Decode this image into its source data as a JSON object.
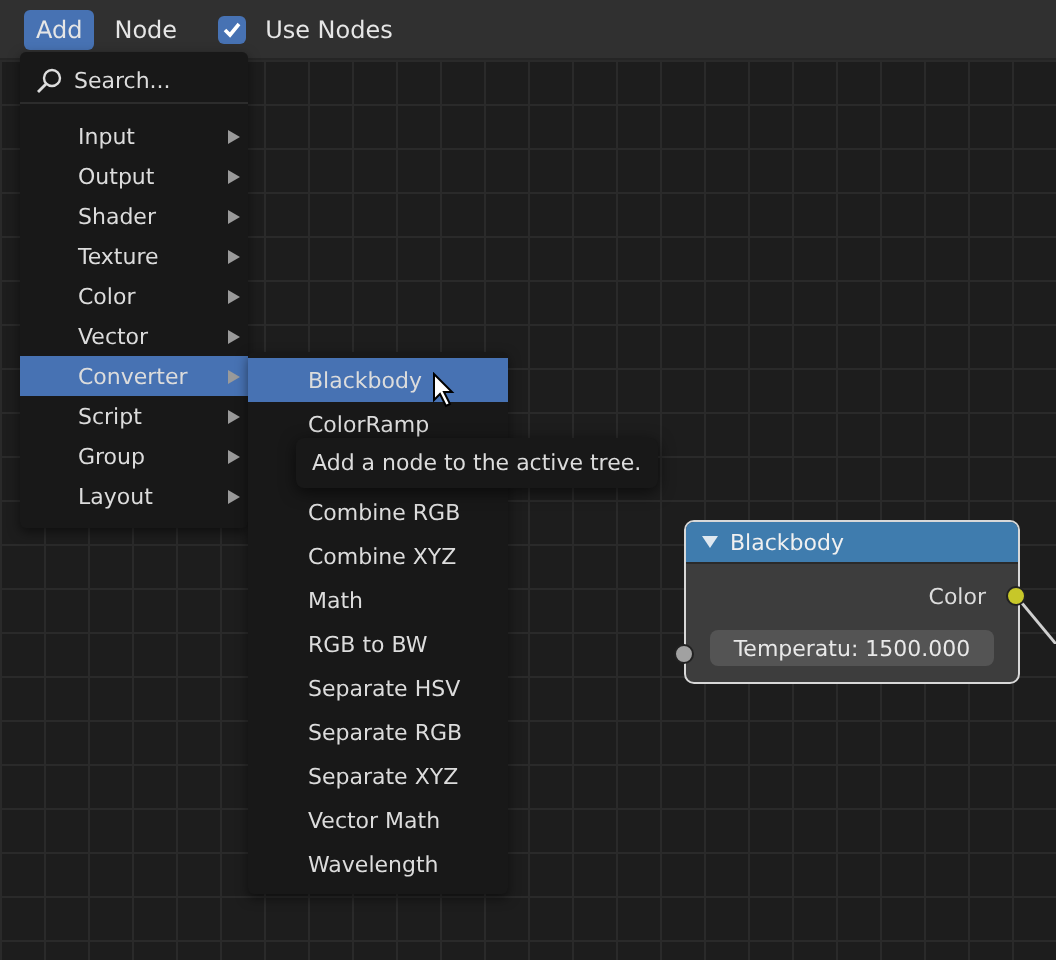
{
  "header": {
    "menus": [
      {
        "label": "Add",
        "selected": true
      },
      {
        "label": "Node",
        "selected": false
      }
    ],
    "use_nodes": {
      "label": "Use Nodes",
      "checked": true
    }
  },
  "add_menu": {
    "search": "Search...",
    "items": [
      {
        "label": "Input",
        "selected": false
      },
      {
        "label": "Output",
        "selected": false
      },
      {
        "label": "Shader",
        "selected": false
      },
      {
        "label": "Texture",
        "selected": false
      },
      {
        "label": "Color",
        "selected": false
      },
      {
        "label": "Vector",
        "selected": false
      },
      {
        "label": "Converter",
        "selected": true
      },
      {
        "label": "Script",
        "selected": false
      },
      {
        "label": "Group",
        "selected": false
      },
      {
        "label": "Layout",
        "selected": false
      }
    ]
  },
  "submenu": {
    "items": [
      {
        "kind": "item",
        "label": "Blackbody",
        "selected": true
      },
      {
        "kind": "item",
        "label": "ColorRamp",
        "selected": false
      },
      {
        "kind": "tooltip",
        "label": "Add a node to the active tree."
      },
      {
        "kind": "item",
        "label": "Combine RGB",
        "selected": false
      },
      {
        "kind": "item",
        "label": "Combine XYZ",
        "selected": false
      },
      {
        "kind": "item",
        "label": "Math",
        "selected": false
      },
      {
        "kind": "item",
        "label": "RGB to BW",
        "selected": false
      },
      {
        "kind": "item",
        "label": "Separate HSV",
        "selected": false
      },
      {
        "kind": "item",
        "label": "Separate RGB",
        "selected": false
      },
      {
        "kind": "item",
        "label": "Separate XYZ",
        "selected": false
      },
      {
        "kind": "item",
        "label": "Vector Math",
        "selected": false
      },
      {
        "kind": "item",
        "label": "Wavelength",
        "selected": false
      }
    ]
  },
  "node": {
    "title": "Blackbody",
    "output": "Color",
    "field": "Temperatu: 1500.000"
  }
}
